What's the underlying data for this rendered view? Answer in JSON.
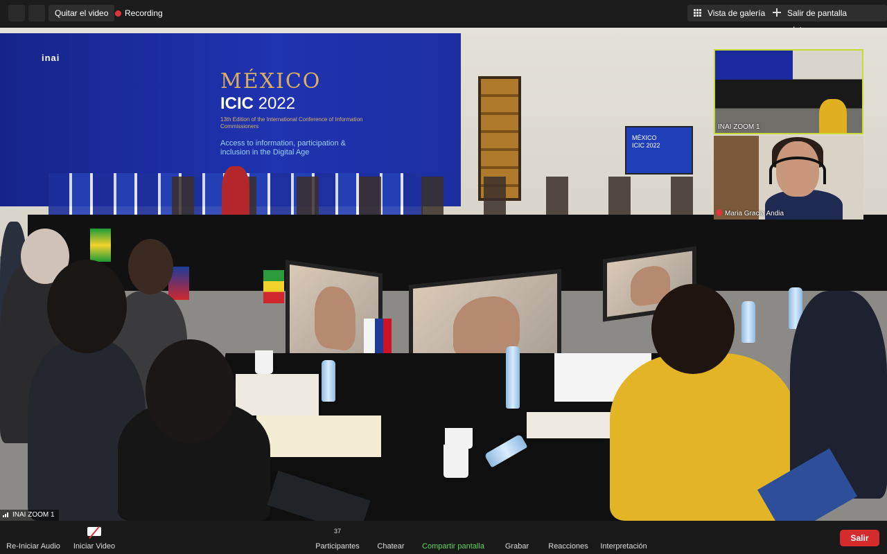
{
  "topbar": {
    "stop_video_label": "Quitar el video",
    "recording_label": "Recording",
    "gallery_view_label": "Vista de galería",
    "exit_fullscreen_label": "Salir de pantalla completa"
  },
  "main_video": {
    "speaker_label": "INAI ZOOM 1",
    "backdrop": {
      "logos": "inai",
      "mexico": "MÉXICO",
      "icic": "ICIC",
      "year": "2022",
      "subtitle": "13th Edition of the International Conference of Information Commissioners",
      "theme": "Access to information, participation & inclusion in the Digital Age"
    },
    "right_screen": {
      "line1": "MÉXICO",
      "line2": "ICIC 2022"
    }
  },
  "thumbnails": [
    {
      "label": "INAI ZOOM 1"
    },
    {
      "label": "Maria Gracia Andia"
    }
  ],
  "toolbar": {
    "unmute_label": "Re-Iniciar Audio",
    "start_video_label": "Iniciar Video",
    "participants_label": "Participantes",
    "participants_count": "37",
    "chat_label": "Chatear",
    "share_label": "Compartir pantalla",
    "record_label": "Grabar",
    "reactions_label": "Reacciones",
    "interpretation_label": "Interpretación",
    "leave_label": "Salir"
  },
  "colors": {
    "recording_dot": "#e0353a",
    "share_green": "#5fd35c",
    "leave_red": "#d42c2c",
    "active_speaker_border": "#c6dc32"
  }
}
